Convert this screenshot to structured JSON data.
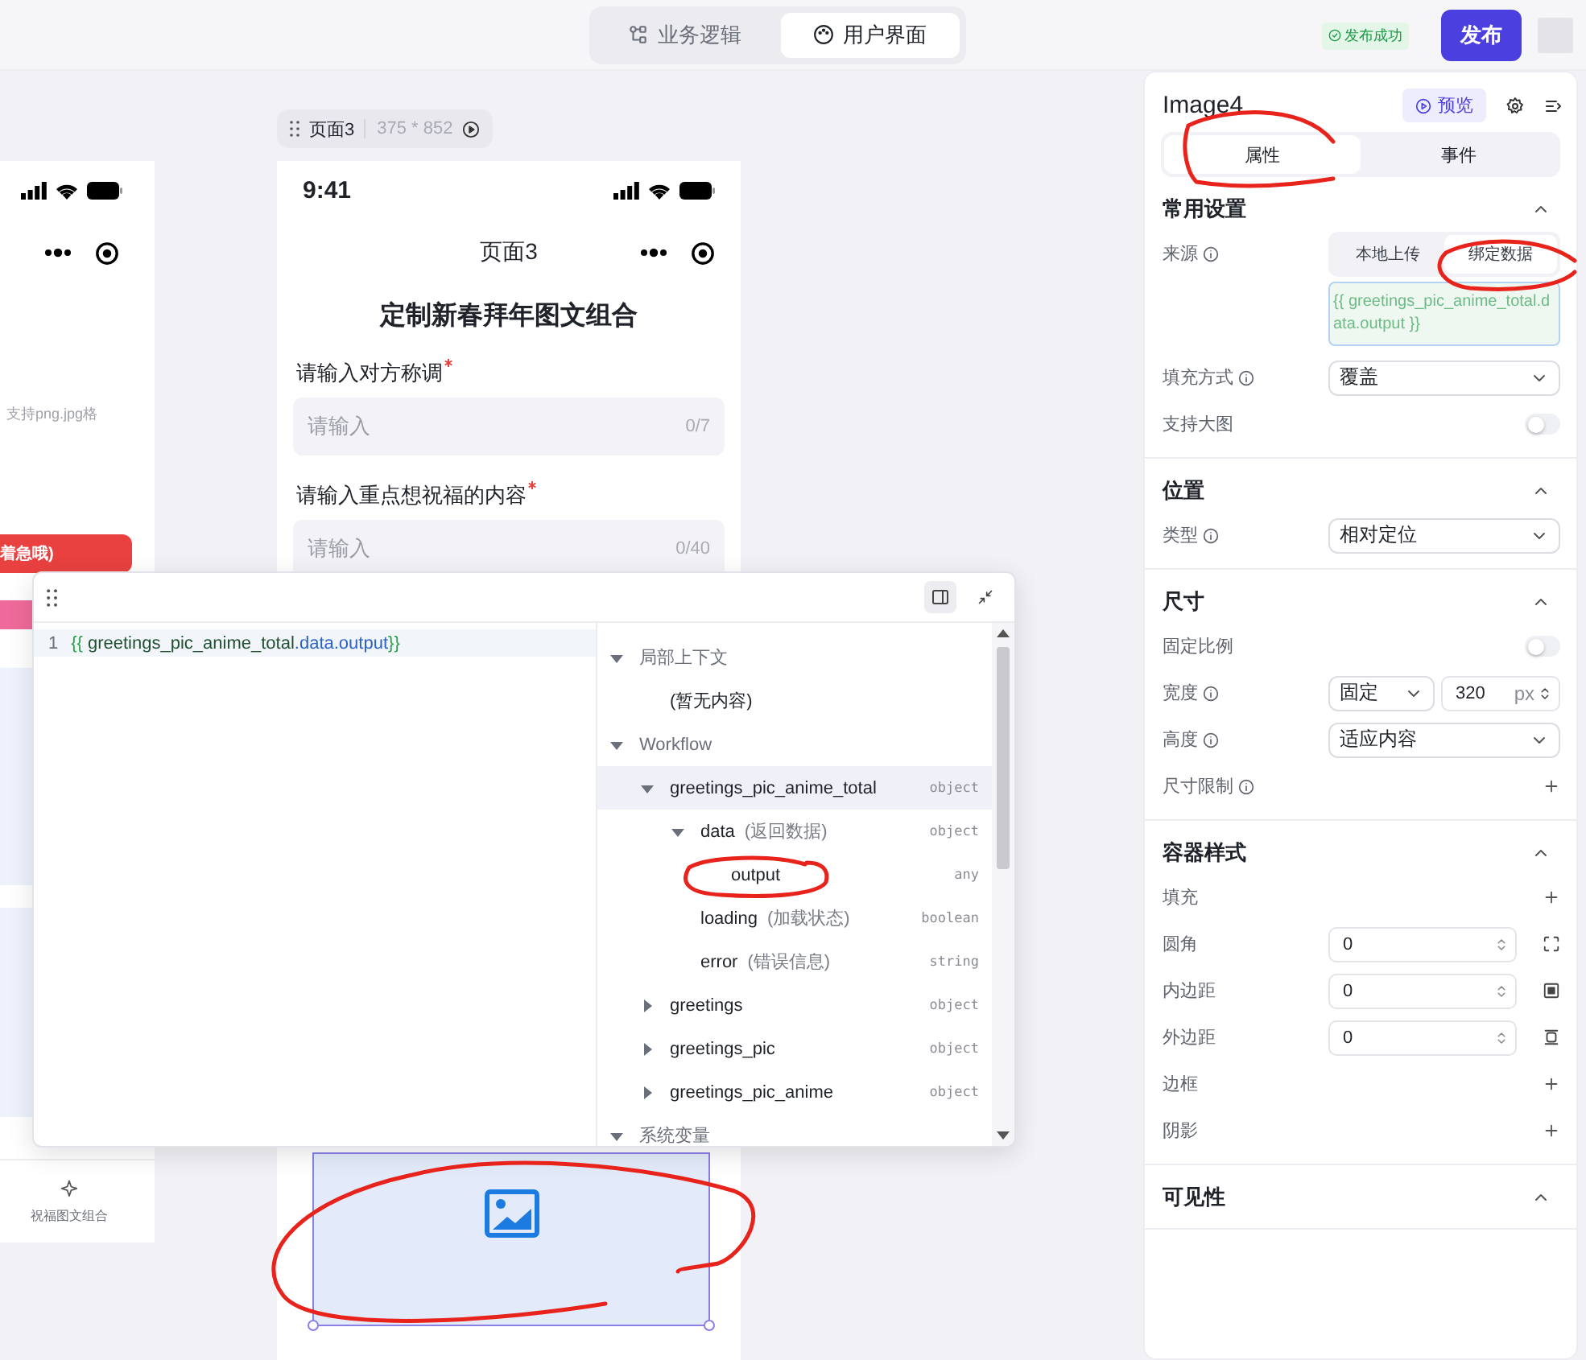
{
  "top_bar": {
    "mode_tabs": [
      {
        "label": "业务逻辑",
        "selected": false
      },
      {
        "label": "用户界面",
        "selected": true
      }
    ],
    "status": "发布成功",
    "publish_button": "发布"
  },
  "canvas": {
    "side_page": {
      "hint": "支持png.jpg格",
      "button": "着急哦)",
      "tool_label": "祝福图文组合"
    },
    "page_tag": {
      "name": "页面3",
      "size": "375 * 852"
    },
    "phone": {
      "time": "9:41",
      "nav_title": "页面3",
      "heading": "定制新春拜年图文组合",
      "fields": [
        {
          "label": "请输入对方称调",
          "required": true,
          "placeholder": "请输入",
          "count": "0/7"
        },
        {
          "label": "请输入重点想祝福的内容",
          "required": true,
          "placeholder": "请输入",
          "count": "0/40"
        }
      ],
      "image_selected": true
    }
  },
  "binding_editor": {
    "line_number": "1",
    "code": [
      {
        "kind": "brace",
        "text": "{{"
      },
      {
        "kind": "var",
        "text": "greetings_pic_anime_total"
      },
      {
        "kind": "prop",
        "text": ".data.output"
      },
      {
        "kind": "brace",
        "text": "}}"
      }
    ],
    "tree": [
      {
        "label": "局部上下文",
        "expanded": true,
        "selected": false,
        "children": [
          {
            "label": "(暂无内容)",
            "selected": false
          }
        ]
      },
      {
        "label": "Workflow",
        "expanded": true,
        "selected": false,
        "children": [
          {
            "label": "greetings_pic_anime_total",
            "type": "object",
            "expanded": true,
            "selected": true,
            "children": [
              {
                "label": "data",
                "note": "(返回数据)",
                "type": "object",
                "expanded": true,
                "selected": false,
                "children": [
                  {
                    "label": "output",
                    "type": "any",
                    "selected": false
                  }
                ]
              },
              {
                "label": "loading",
                "note": "(加载状态)",
                "type": "boolean",
                "selected": false
              },
              {
                "label": "error",
                "note": "(错误信息)",
                "type": "string",
                "selected": false
              }
            ]
          },
          {
            "label": "greetings",
            "type": "object",
            "expanded": false,
            "selected": false
          },
          {
            "label": "greetings_pic",
            "type": "object",
            "expanded": false,
            "selected": false
          },
          {
            "label": "greetings_pic_anime",
            "type": "object",
            "expanded": false,
            "selected": false
          }
        ]
      },
      {
        "label": "系统变量",
        "expanded": true,
        "selected": false
      }
    ]
  },
  "properties_panel": {
    "title": "Image4",
    "preview_button": "预览",
    "tabs": [
      {
        "label": "属性",
        "selected": true
      },
      {
        "label": "事件",
        "selected": false
      }
    ],
    "sections": [
      {
        "title": "常用设置",
        "expanded": true,
        "rows": [
          {
            "kind": "segmented",
            "label": "来源",
            "info": true,
            "options": [
              {
                "label": "本地上传",
                "selected": false
              },
              {
                "label": "绑定数据",
                "selected": true
              }
            ]
          },
          {
            "kind": "binding",
            "value": "{{ greetings_pic_anime_total.data.output }}"
          },
          {
            "kind": "select",
            "label": "填充方式",
            "info": true,
            "value": "覆盖"
          },
          {
            "kind": "switch",
            "label": "支持大图",
            "on": false
          }
        ]
      },
      {
        "title": "位置",
        "expanded": true,
        "rows": [
          {
            "kind": "select",
            "label": "类型",
            "info": true,
            "value": "相对定位"
          }
        ]
      },
      {
        "title": "尺寸",
        "expanded": true,
        "rows": [
          {
            "kind": "switch",
            "label": "固定比例",
            "on": false
          },
          {
            "kind": "size",
            "label": "宽度",
            "info": true,
            "mode": "固定",
            "value": "320",
            "unit": "px"
          },
          {
            "kind": "select",
            "label": "高度",
            "info": true,
            "value": "适应内容"
          },
          {
            "kind": "add",
            "label": "尺寸限制",
            "info": true
          }
        ]
      },
      {
        "title": "容器样式",
        "expanded": true,
        "rows": [
          {
            "kind": "add",
            "label": "填充"
          },
          {
            "kind": "number",
            "label": "圆角",
            "value": "0"
          },
          {
            "kind": "number",
            "label": "内边距",
            "value": "0"
          },
          {
            "kind": "number",
            "label": "外边距",
            "value": "0"
          },
          {
            "kind": "add",
            "label": "边框"
          },
          {
            "kind": "add",
            "label": "阴影"
          }
        ]
      },
      {
        "title": "可见性",
        "expanded": true
      }
    ]
  }
}
